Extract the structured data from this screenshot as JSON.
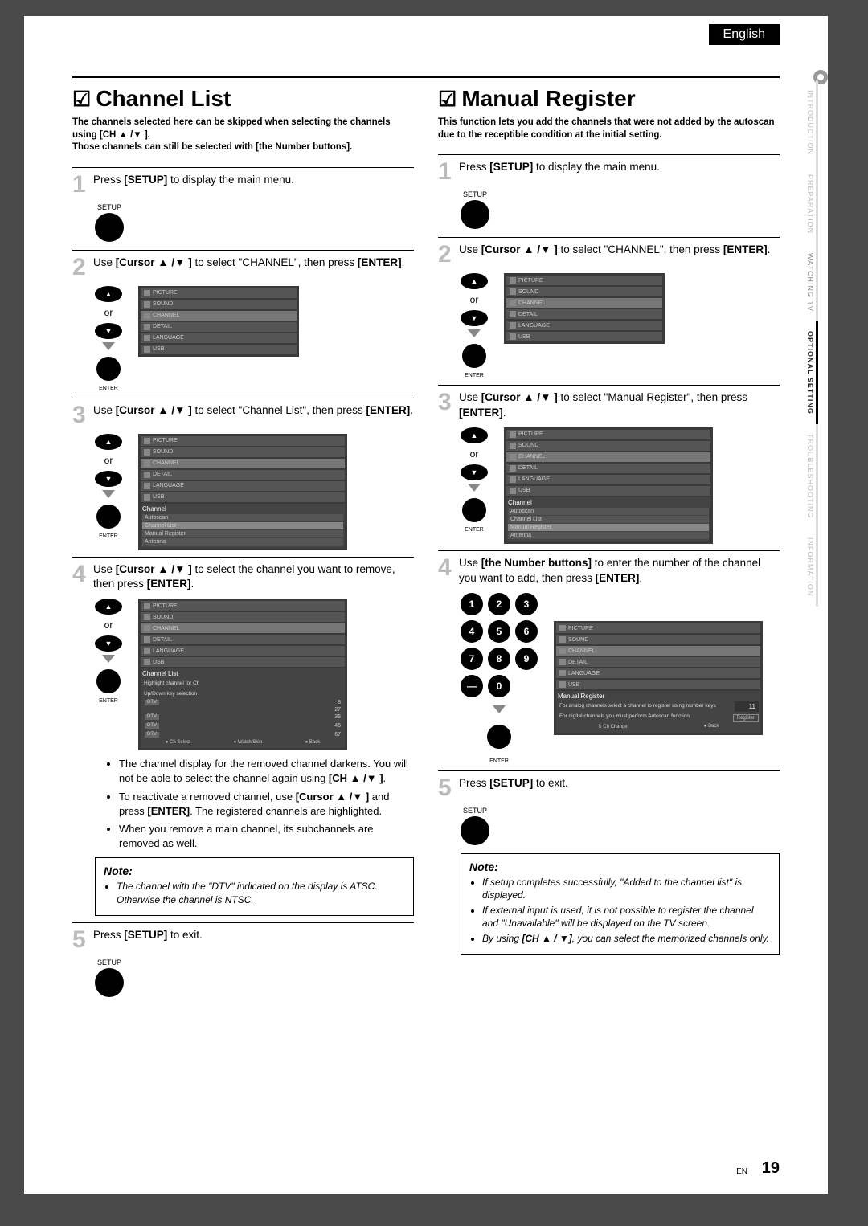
{
  "lang": "English",
  "side_tabs": [
    "INTRODUCTION",
    "PREPARATION",
    "WATCHING  TV",
    "OPTIONAL  SETTING",
    "TROUBLESHOOTING",
    "INFORMATION"
  ],
  "side_active_index": 3,
  "page_number": "19",
  "page_footer": "EN",
  "left": {
    "title": "Channel List",
    "intro": "The channels selected here can be skipped when selecting the channels using [CH ▲ /▼ ].\nThose channels can still be selected with [the Number buttons].",
    "steps": {
      "1": "Press <b>[SETUP]</b> to display the main menu.",
      "2": "Use <b>[Cursor ▲ /▼ ]</b> to select \"CHANNEL\", then press <b>[ENTER]</b>.",
      "3": "Use <b>[Cursor ▲ /▼ ]</b> to select \"Channel List\", then press <b>[ENTER]</b>.",
      "4": "Use <b>[Cursor ▲ /▼ ]</b> to select the channel you want to remove, then press <b>[ENTER]</b>.",
      "5": "Press <b>[SETUP]</b> to exit."
    },
    "bullets": [
      "The channel display for the removed channel darkens. You will not be able to select the channel again using <b>[CH ▲ /▼ ]</b>.",
      "To reactivate a removed channel, use <b>[Cursor ▲ /▼ ]</b> and press <b>[ENTER]</b>. The registered channels are highlighted.",
      "When you remove a main channel, its subchannels are removed as well."
    ],
    "note_title": "Note:",
    "note_items": [
      "The channel with the \"DTV\" indicated on the display is ATSC. Otherwise the channel is NTSC."
    ]
  },
  "right": {
    "title": "Manual Register",
    "intro": "This function lets you add the channels that were not added by the autoscan due to the receptible condition at the initial setting.",
    "steps": {
      "1": "Press <b>[SETUP]</b> to display the main menu.",
      "2": "Use <b>[Cursor ▲ /▼ ]</b> to select \"CHANNEL\", then press <b>[ENTER]</b>.",
      "3": "Use <b>[Cursor ▲ /▼ ]</b> to select \"Manual Register\", then press <b>[ENTER]</b>.",
      "4": "Use <b>[the Number buttons]</b> to enter the number of the channel you want to add, then press <b>[ENTER]</b>.",
      "5": "Press <b>[SETUP]</b> to exit."
    },
    "note_title": "Note:",
    "note_items": [
      "If setup completes successfully, \"Added to the channel list\" is displayed.",
      "If external input is used, it is not possible to register the channel and \"Unavailable\" will be displayed on the TV screen.",
      "By using <b>[CH ▲ / ▼]</b>, you can select the memorized channels only."
    ]
  },
  "osd": {
    "menu_items": [
      "PICTURE",
      "SOUND",
      "CHANNEL",
      "DETAIL",
      "LANGUAGE",
      "USB"
    ],
    "channel_head": "Channel",
    "channel_items": [
      "Autoscan",
      "Channel List",
      "Manual Register",
      "Antenna"
    ],
    "chlist_head": "Channel List",
    "chlist_hint1": "Highlight channel for Ch",
    "chlist_hint2": "Up/Down key selection",
    "chlist_rows": [
      {
        "tag": "DTV",
        "num": "8"
      },
      {
        "tag": "",
        "num": "27"
      },
      {
        "tag": "DTV",
        "num": "36"
      },
      {
        "tag": "",
        "num": ""
      },
      {
        "tag": "DTV",
        "num": "46"
      },
      {
        "tag": "",
        "num": ""
      },
      {
        "tag": "DTV",
        "num": "67"
      }
    ],
    "chlist_foot1": "Ch Select",
    "chlist_foot2": "Watch/Skip",
    "chlist_foot3": "Back",
    "mr_head": "Manual Register",
    "mr_num": "11",
    "mr_txt1": "For analog channels select a channel to register using number keys",
    "mr_txt2": "For digital channels you must perform Autoscan function",
    "mr_btn": "Register",
    "mr_foot1": "Ch Change",
    "mr_foot2": "Back"
  },
  "labels": {
    "setup": "SETUP",
    "enter": "ENTER",
    "or": "or"
  },
  "numpad": [
    "1",
    "2",
    "3",
    "4",
    "5",
    "6",
    "7",
    "8",
    "9",
    "—",
    "0"
  ]
}
